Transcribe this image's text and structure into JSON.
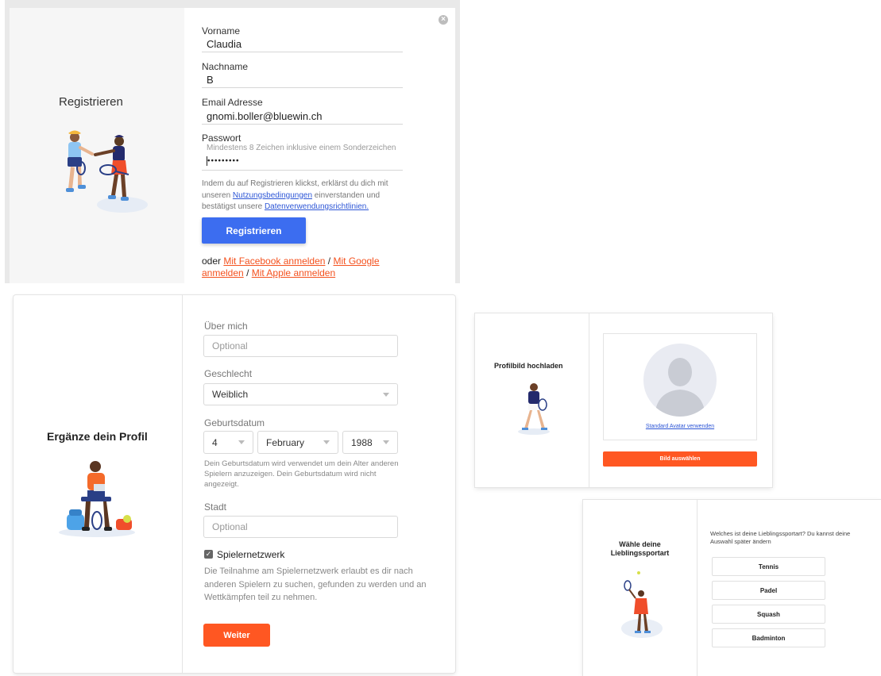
{
  "register": {
    "title": "Registrieren",
    "first_name_label": "Vorname",
    "first_name_value": "Claudia",
    "last_name_label": "Nachname",
    "last_name_value": "B",
    "email_label": "Email Adresse",
    "email_value": "gnomi.boller@bluewin.ch",
    "password_label": "Passwort",
    "password_hint": "Mindestens 8 Zeichen inklusive einem Sonderzeichen",
    "password_value": "•••••••••",
    "terms_prefix": "Indem du auf Registrieren klickst, erklärst du dich mit unseren",
    "terms_link": "Nutzungsbedingungen",
    "terms_middle": "einverstanden und bestätigst unsere",
    "privacy_link": "Datenverwendungsrichtlinien.",
    "submit_label": "Registrieren",
    "social_prefix": "oder",
    "facebook_link": "Mit Facebook anmelden",
    "google_link": "Mit Google anmelden",
    "apple_link": "Mit Apple anmelden",
    "separator": "/"
  },
  "profile": {
    "title": "Ergänze dein Profil",
    "about_label": "Über mich",
    "about_placeholder": "Optional",
    "gender_label": "Geschlecht",
    "gender_value": "Weiblich",
    "birth_label": "Geburtsdatum",
    "birth_day": "4",
    "birth_month": "February",
    "birth_year": "1988",
    "birth_note": "Dein Geburtsdatum wird verwendet um dein Alter anderen Spielern anzuzeigen. Dein Geburtsdatum wird nicht angezeigt.",
    "city_label": "Stadt",
    "city_placeholder": "Optional",
    "network_label": "Spielernetzwerk",
    "network_checked": true,
    "network_note": "Die Teilnahme am Spielernetzwerk erlaubt es dir nach anderen Spielern zu suchen, gefunden zu werden und an Wettkämpfen teil zu nehmen.",
    "next_label": "Weiter"
  },
  "avatar": {
    "title": "Profilbild hochladen",
    "default_link": "Standard Avatar verwenden",
    "choose_label": "Bild auswählen"
  },
  "sport": {
    "title_line1": "Wähle deine",
    "title_line2": "Lieblingssportart",
    "question": "Welches ist deine Lieblingssportart? Du kannst deine Auswahl später ändern",
    "options": [
      "Tennis",
      "Padel",
      "Squash",
      "Badminton"
    ]
  },
  "colors": {
    "primary_blue": "#3c6df0",
    "accent_orange": "#ff5722",
    "link_blue": "#2d56d6"
  }
}
